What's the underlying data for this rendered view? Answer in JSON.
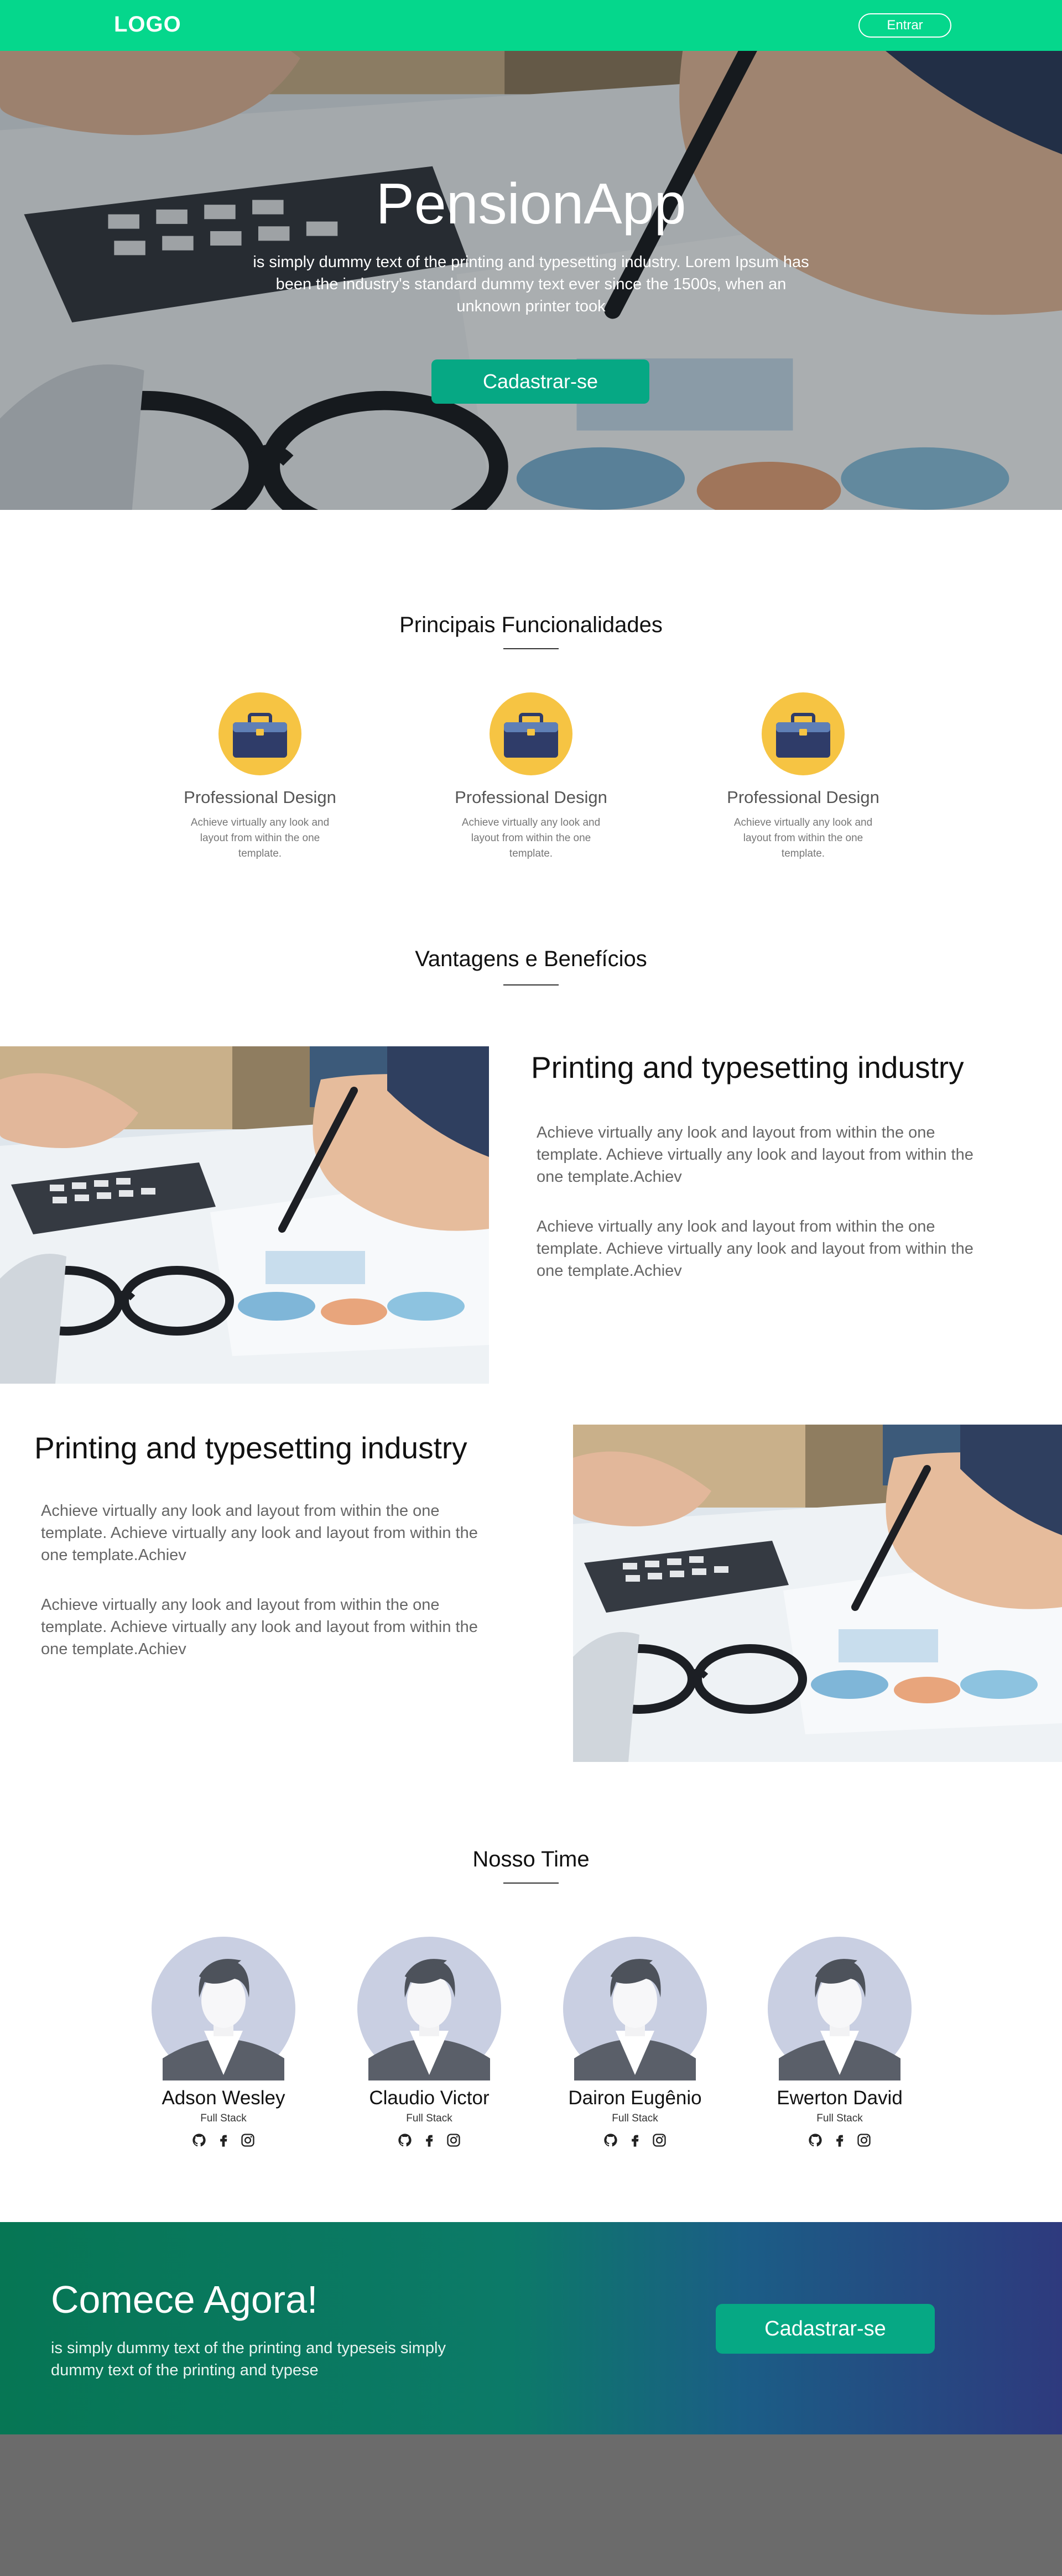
{
  "nav": {
    "logo": "LOGO",
    "login_label": "Entrar"
  },
  "hero": {
    "title": "PensionApp",
    "text": "is simply dummy text of the printing and typesetting industry. Lorem Ipsum has been the industry's standard dummy text ever since the 1500s, when an unknown printer took",
    "cta_label": "Cadastrar-se"
  },
  "features": {
    "title": "Principais Funcionalidades",
    "items": [
      {
        "icon": "briefcase-icon",
        "title": "Professional Design",
        "text": "Achieve virtually any look and layout from within the one template."
      },
      {
        "icon": "briefcase-icon",
        "title": "Professional Design",
        "text": "Achieve virtually any look and layout from within the one template."
      },
      {
        "icon": "briefcase-icon",
        "title": "Professional Design",
        "text": "Achieve virtually any look and layout from within the one template."
      }
    ]
  },
  "benefits": {
    "title": "Vantagens e Benefícios",
    "blocks": [
      {
        "heading": "Printing and typesetting industry",
        "paragraphs": [
          "Achieve virtually any look and layout from within the one template. Achieve virtually any look and layout from within the one template.Achiev",
          "Achieve virtually any look and layout from within the one template. Achieve virtually any look and layout from within the one template.Achiev"
        ]
      },
      {
        "heading": "Printing and typesetting industry",
        "paragraphs": [
          "Achieve virtually any look and layout from within the one template. Achieve virtually any look and layout from within the one template.Achiev",
          "Achieve virtually any look and layout from within the one template. Achieve virtually any look and layout from within the one template.Achiev"
        ]
      }
    ]
  },
  "team": {
    "title": "Nosso Time",
    "members": [
      {
        "name": "Adson Wesley",
        "role": "Full Stack"
      },
      {
        "name": "Claudio Victor",
        "role": "Full Stack"
      },
      {
        "name": "Dairon Eugênio",
        "role": "Full Stack"
      },
      {
        "name": "Ewerton David",
        "role": "Full Stack"
      }
    ],
    "social_icons": [
      "github-icon",
      "facebook-icon",
      "instagram-icon"
    ]
  },
  "cta": {
    "title": "Comece Agora!",
    "text": "is simply dummy text of the printing and typeseis simply dummy text of the printing and typese",
    "button_label": "Cadastrar-se"
  },
  "colors": {
    "brand_green": "#05d78c",
    "button_teal": "#06a884",
    "icon_yellow": "#f6c443",
    "icon_navy": "#2f3c69",
    "footer_gray": "#6b6b6b"
  }
}
